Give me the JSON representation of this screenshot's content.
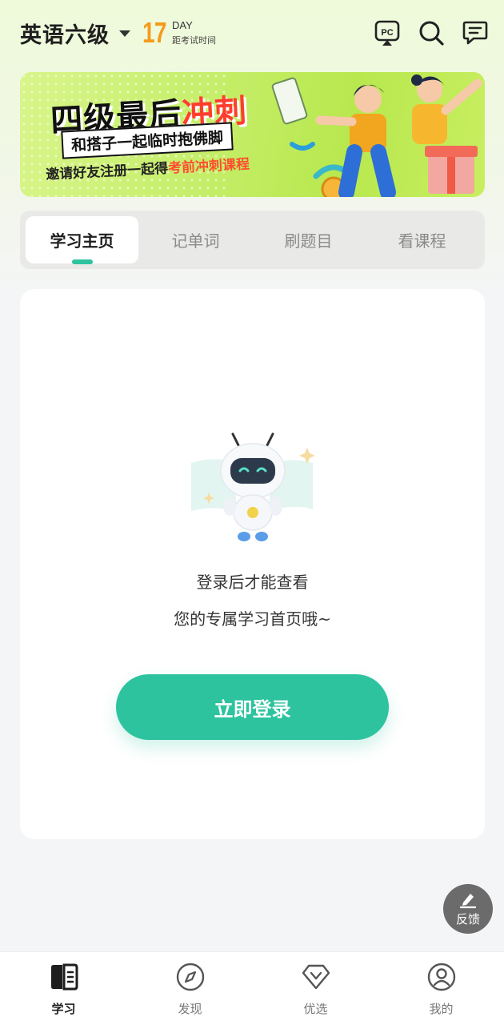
{
  "header": {
    "exam_name": "英语六级",
    "countdown_days": "17",
    "countdown_unit": "DAY",
    "countdown_caption": "距考试时间"
  },
  "banner": {
    "title_plain": "四级最后",
    "title_highlight": "冲刺",
    "subtitle": "和搭子一起临时抱佛脚",
    "invite_plain": "邀请好友注册一起得",
    "invite_highlight": "考前冲刺课程"
  },
  "tabs": [
    {
      "label": "学习主页",
      "active": true
    },
    {
      "label": "记单词",
      "active": false
    },
    {
      "label": "刷题目",
      "active": false
    },
    {
      "label": "看课程",
      "active": false
    }
  ],
  "empty_state": {
    "line1": "登录后才能查看",
    "line2": "您的专属学习首页哦~",
    "login_button": "立即登录"
  },
  "feedback": {
    "label": "反馈"
  },
  "bottom_nav": [
    {
      "label": "学习",
      "icon": "book-icon",
      "active": true
    },
    {
      "label": "发现",
      "icon": "compass-icon",
      "active": false
    },
    {
      "label": "优选",
      "icon": "diamond-icon",
      "active": false
    },
    {
      "label": "我的",
      "icon": "user-icon",
      "active": false
    }
  ],
  "colors": {
    "accent": "#2dc39e",
    "countdown": "#f59a1b",
    "banner_highlight": "#ff3d2e"
  }
}
